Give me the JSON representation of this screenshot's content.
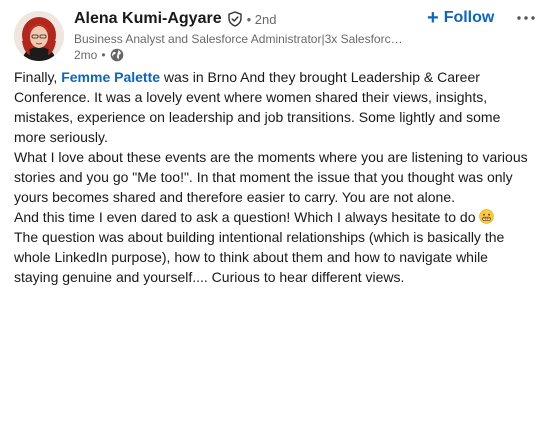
{
  "author": {
    "name": "Alena Kumi-Agyare",
    "degree": "• 2nd",
    "headline": "Business Analyst and Salesforce Administrator|3x Salesforc…",
    "time": "2mo",
    "separator": "•",
    "verified_icon": "verified-shield-icon",
    "visibility_icon": "globe-icon"
  },
  "actions": {
    "follow_icon": "+",
    "follow_label": "Follow",
    "more_icon": "more-horizontal-icon"
  },
  "post": {
    "p1_before": "Finally, ",
    "p1_mention": "Femme Palette",
    "p1_after": " was in Brno And they brought Leadership & Career Conference. It was a lovely event where women shared their views, insights, mistakes, experience on leadership and job transitions. Some lightly and some more seriously.",
    "p2": "What I love about these events are the moments where you are listening to various stories and you go \"Me too!\". In that moment the issue that you thought was only yours becomes shared and therefore easier to carry. You are not alone.",
    "p3": "And this time I even dared to ask a question! Which I always hesitate to do ",
    "p3_emoji": "grimacing-face-emoji",
    "p4": "The question was about building intentional relationships (which is basically the whole LinkedIn purpose), how to think about them and how to navigate while staying genuine and yourself.... Curious to hear different views."
  },
  "colors": {
    "brand_blue": "#0a66c2",
    "text_primary": "#191919",
    "text_secondary": "#666666"
  }
}
